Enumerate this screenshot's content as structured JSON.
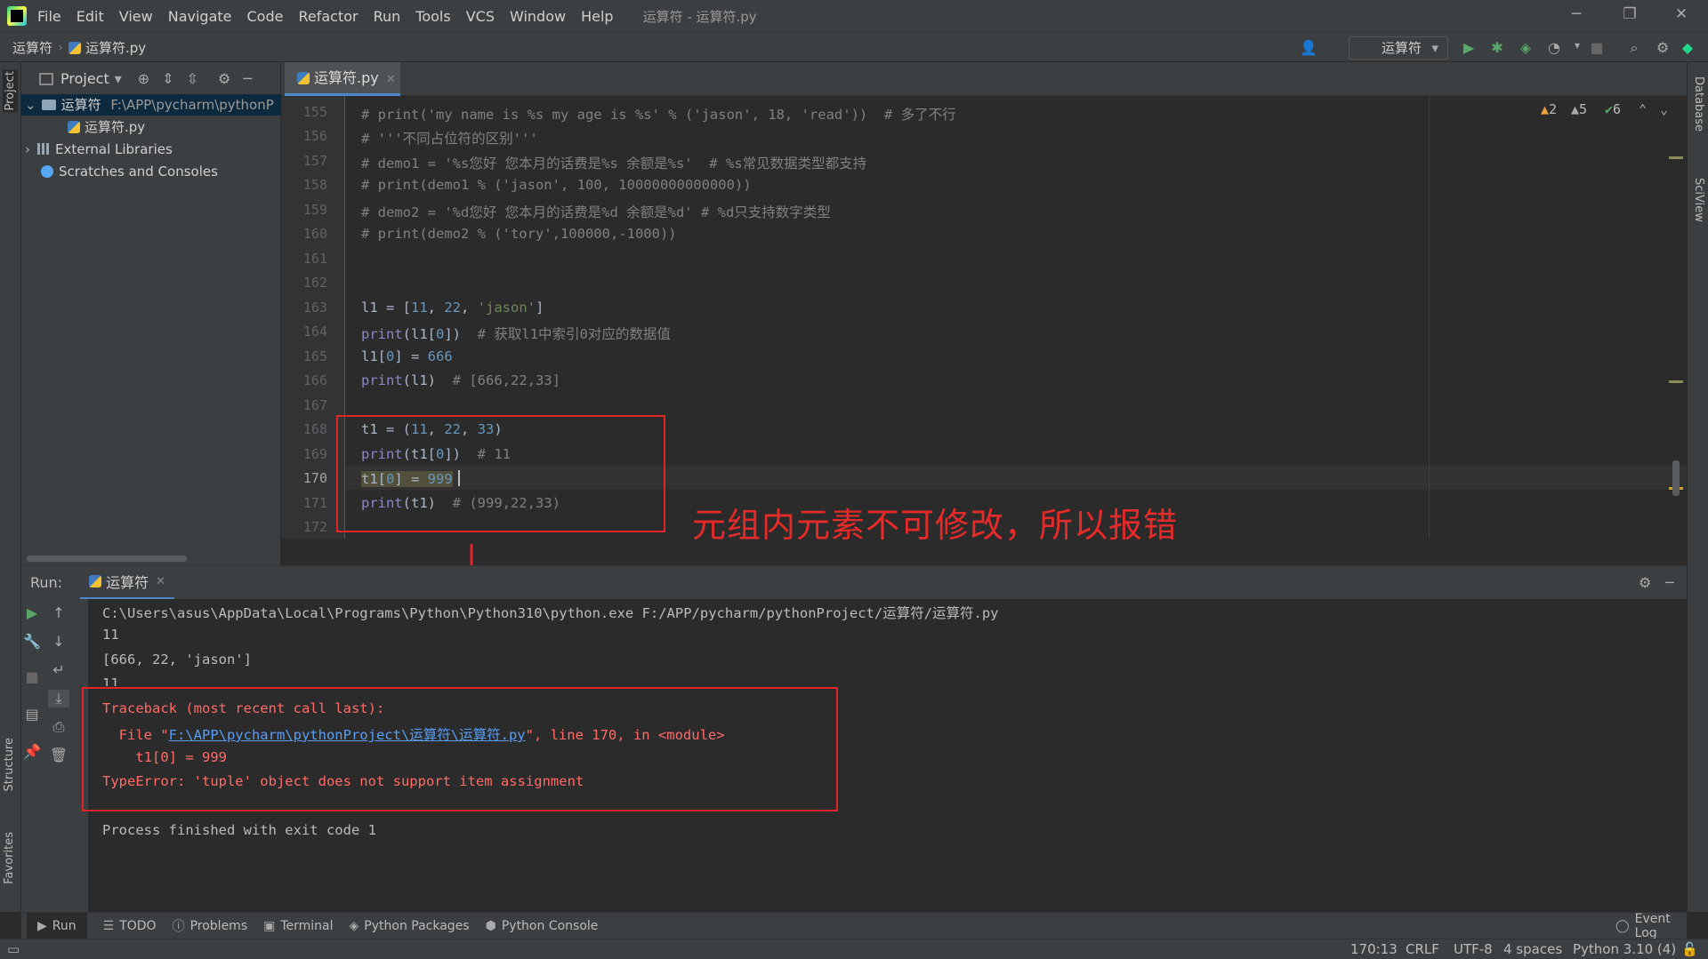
{
  "app": {
    "window_title": "运算符 - 运算符.py",
    "menu": [
      "File",
      "Edit",
      "View",
      "Navigate",
      "Code",
      "Refactor",
      "Run",
      "Tools",
      "VCS",
      "Window",
      "Help"
    ]
  },
  "navbar": {
    "project": "运算符",
    "file": "运算符.py",
    "run_config": "运算符"
  },
  "project_panel": {
    "title": "Project",
    "root_name": "运算符",
    "root_path": "F:\\APP\\pycharm\\pythonP",
    "file": "运算符.py",
    "external_libraries": "External Libraries",
    "scratches": "Scratches and Consoles"
  },
  "left_stripe": {
    "project": "Project",
    "structure": "Structure",
    "favorites": "Favorites"
  },
  "right_stripe": {
    "database": "Database",
    "sciview": "SciView"
  },
  "editor": {
    "tab": "运算符.py",
    "inspections": {
      "warn1": "2",
      "warn2": "5",
      "ok": "6"
    },
    "line_numbers": [
      "155",
      "156",
      "157",
      "158",
      "159",
      "160",
      "161",
      "162",
      "163",
      "164",
      "165",
      "166",
      "167",
      "168",
      "169",
      "170",
      "171",
      "172"
    ],
    "lines": {
      "l155": "# print('my name is %s my age is %s' % ('jason', 18, 'read'))  # 多了不行",
      "l156": "# '''不同占位符的区别'''",
      "l157": "# demo1 = '%s您好 您本月的话费是%s 余额是%s'  # %s常见数据类型都支持",
      "l158": "# print(demo1 % ('jason', 100, 10000000000000))",
      "l159": "# demo2 = '%d您好 您本月的话费是%d 余额是%d' # %d只支持数字类型",
      "l160": "# print(demo2 % ('tory',100000,-1000))",
      "l164_comment": "# 获取l1中索引0对应的数据值",
      "l166_comment": "# [666,22,33]",
      "l169_comment": "# 11",
      "l171_comment": "# (999,22,33)"
    }
  },
  "annotation": "元组内元素不可修改，所以报错",
  "run": {
    "label": "Run:",
    "tab": "运算符",
    "output": [
      "C:\\Users\\asus\\AppData\\Local\\Programs\\Python\\Python310\\python.exe F:/APP/pycharm/pythonProject/运算符/运算符.py",
      "11",
      "[666, 22, 'jason']",
      "11"
    ],
    "traceback": {
      "header": "Traceback (most recent call last):",
      "file_prefix": "  File \"",
      "file_link": "F:\\APP\\pycharm\\pythonProject\\运算符\\运算符.py",
      "file_suffix": "\", line 170, in <module>",
      "code": "    t1[0] = 999",
      "error": "TypeError: 'tuple' object does not support item assignment"
    },
    "finished": "Process finished with exit code 1"
  },
  "bottom_tabs": [
    "Run",
    "TODO",
    "Problems",
    "Terminal",
    "Python Packages",
    "Python Console"
  ],
  "event_log": "Event Log",
  "status": {
    "position": "170:13",
    "line_sep": "CRLF",
    "encoding": "UTF-8",
    "indent": "4 spaces",
    "interpreter": "Python 3.10 (4)"
  },
  "colors": {
    "annotation_red": "#e52a2a",
    "error_text": "#ff6b68",
    "link": "#589df6"
  }
}
